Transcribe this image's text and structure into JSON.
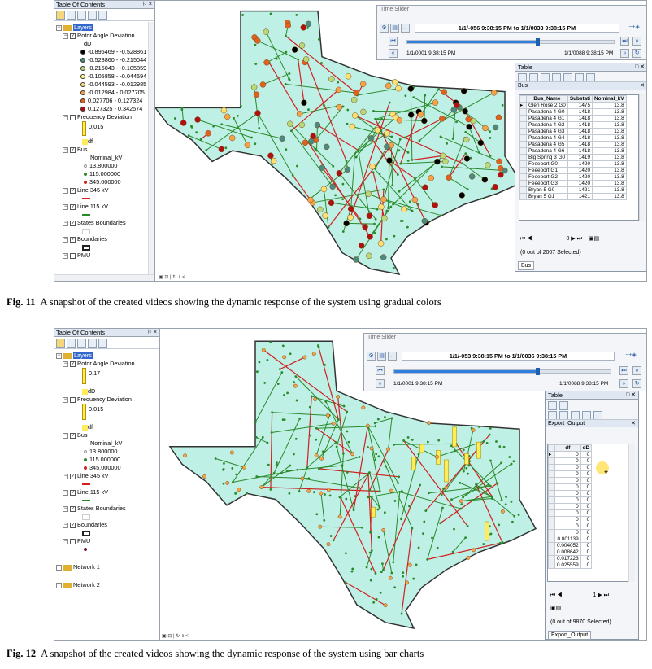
{
  "fig1": {
    "toc": {
      "title": "Table Of Contents",
      "pin": "⚐ ×",
      "layers_label": "Layers",
      "rotor_label": "Rotor Angle Deviation",
      "dd_field": "dD",
      "rotor_classes": [
        {
          "label": "-0.895469 - -0.528861",
          "color": "#000000"
        },
        {
          "label": "-0.528860 - -0.215044",
          "color": "#4a8a80"
        },
        {
          "label": "-0.215043 - -0.105859",
          "color": "#b9d87a"
        },
        {
          "label": "-0.105858 - -0.044594",
          "color": "#ffff88"
        },
        {
          "label": "-0.044593 - -0.012985",
          "color": "#ffe070"
        },
        {
          "label": "-0.012984 - 0.027705",
          "color": "#f6a24a"
        },
        {
          "label": "0.027706 - 0.127324",
          "color": "#e06020"
        },
        {
          "label": "0.127325 - 0.342574",
          "color": "#b01010"
        }
      ],
      "freq_label": "Frequency Deviation",
      "freq_value": "0.015",
      "freq_field": "df",
      "bus_label": "Bus",
      "bus_field": "Nominal_kV",
      "bus_classes": [
        {
          "label": "13.800000",
          "color": "#ffffff"
        },
        {
          "label": "115.000000",
          "color": "#2a8a2a"
        },
        {
          "label": "345.000000",
          "color": "#d02020"
        }
      ],
      "line345_label": "Line 345 kV",
      "line115_label": "Line 115 kV",
      "states_label": "States Boundaries",
      "boundaries_label": "Boundaries",
      "pmu_label": "PMU"
    },
    "time_slider": {
      "title": "Time Slider",
      "range": "1/1/-056 9:38:15 PM to 1/1/0033 9:38:15 PM",
      "start": "1/1/0001 9:38:15 PM",
      "end": "1/1/0088 9:38:15 PM",
      "progress": 0.63
    },
    "table": {
      "title": "Table",
      "tab": "Bus",
      "columns": [
        "Bus_Name",
        "Substati",
        "Nominal_kV"
      ],
      "rows": [
        [
          "Glen Rose 2 G0",
          "1475",
          "13.8"
        ],
        [
          "Pasadena 4 G0",
          "1418",
          "13.8"
        ],
        [
          "Pasadena 4 G1",
          "1418",
          "13.8"
        ],
        [
          "Pasadena 4 G2",
          "1418",
          "13.8"
        ],
        [
          "Pasadena 4 G3",
          "1418",
          "13.8"
        ],
        [
          "Pasadena 4 G4",
          "1418",
          "13.8"
        ],
        [
          "Pasadena 4 G5",
          "1418",
          "13.8"
        ],
        [
          "Pasadena 4 G6",
          "1418",
          "13.8"
        ],
        [
          "Big Spring 3 G0",
          "1419",
          "13.8"
        ],
        [
          "Feeeport G0",
          "1420",
          "13.8"
        ],
        [
          "Feeeport G1",
          "1420",
          "13.8"
        ],
        [
          "Feeeport G2",
          "1420",
          "13.8"
        ],
        [
          "Feeeport G3",
          "1420",
          "13.8"
        ],
        [
          "Bryan 5 G0",
          "1421",
          "13.8"
        ],
        [
          "Bryan 5 G1",
          "1421",
          "13.8"
        ]
      ],
      "record": "0",
      "selected": "(0 out of 2007 Selected)",
      "bottom_tab": "Bus"
    }
  },
  "fig2": {
    "toc": {
      "title": "Table Of Contents",
      "pin": "⚐ ×",
      "layers_label": "Layers",
      "rotor_label": "Rotor Angle Deviation",
      "rotor_value": "0.17",
      "dd_field": "dD",
      "freq_label": "Frequency Deviation",
      "freq_value": "0.015",
      "freq_field": "df",
      "bus_label": "Bus",
      "bus_field": "Nominal_kV",
      "bus_classes": [
        {
          "label": "13.800000",
          "color": "#ffffff"
        },
        {
          "label": "115.000000",
          "color": "#2a8a2a"
        },
        {
          "label": "345.000000",
          "color": "#d02020"
        }
      ],
      "line345_label": "Line 345 kV",
      "line115_label": "Line 115 kV",
      "states_label": "States Boundaries",
      "boundaries_label": "Boundaries",
      "pmu_label": "PMU",
      "network1_label": "Network 1",
      "network2_label": "Network 2"
    },
    "time_slider": {
      "title": "Time Slider",
      "range": "1/1/-053 9:38:15 PM to 1/1/0036 9:38:15 PM",
      "start": "1/1/0001 9:38:15 PM",
      "end": "1/1/0088 9:38:15 PM",
      "progress": 0.66
    },
    "table": {
      "title": "Table",
      "tab": "Export_Output",
      "columns": [
        "df",
        "dD"
      ],
      "rows": [
        [
          "0",
          "0"
        ],
        [
          "0",
          "0"
        ],
        [
          "0",
          "0"
        ],
        [
          "0",
          "0"
        ],
        [
          "0",
          "0"
        ],
        [
          "0",
          "0"
        ],
        [
          "0",
          "0"
        ],
        [
          "0",
          "0"
        ],
        [
          "0",
          "0"
        ],
        [
          "0",
          "0"
        ],
        [
          "0",
          "0"
        ],
        [
          "0",
          "0"
        ],
        [
          "0",
          "0"
        ],
        [
          "0.001139",
          "0"
        ],
        [
          "0.004052",
          "0"
        ],
        [
          "0.008642",
          "0"
        ],
        [
          "0.017223",
          "0"
        ],
        [
          "0.025559",
          "0"
        ]
      ],
      "record": "1",
      "selected": "(0 out of 9870 Selected)",
      "bottom_tab": "Export_Output"
    }
  },
  "captions": {
    "fig11_num": "Fig. 11",
    "fig11_text": "A snapshot of the created videos showing the dynamic response of the system using gradual colors",
    "fig12_num": "Fig. 12",
    "fig12_text": "A snapshot of the created videos showing the dynamic response of the system using bar charts"
  },
  "colors": {
    "texas_fill": "#bff0e6",
    "line_345": "#d02020",
    "line_115": "#2a8a2a",
    "bar": "#ffec5a"
  }
}
